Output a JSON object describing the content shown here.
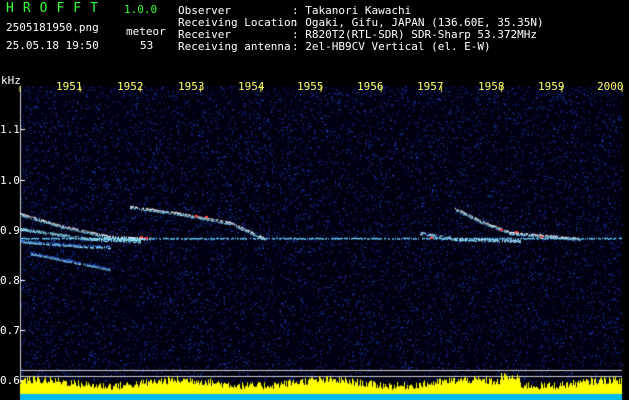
{
  "header": {
    "app_title": "HROFFT",
    "app_version": "1.0.0",
    "file_name": "2505181950.png",
    "timestamp": "25.05.18 19:50",
    "meteor_label": "meteor",
    "meteor_count": "53"
  },
  "info": [
    {
      "key": "Observer",
      "value": ": Takanori Kawachi"
    },
    {
      "key": "Receiving Location",
      "value": ": Ogaki, Gifu, JAPAN (136.60E, 35.35N)"
    },
    {
      "key": "Receiver",
      "value": ": R820T2(RTL-SDR) SDR-Sharp 53.372MHz"
    },
    {
      "key": "Receiving antenna",
      "value": ": 2el-HB9CV Vertical (el. E-W)"
    }
  ],
  "spectrogram": {
    "unit_label": "kHz",
    "y_labels": [
      "1.1",
      "1.0",
      "0.9",
      "0.8",
      "0.7",
      "0.6"
    ],
    "x_labels": [
      "1951",
      "1952",
      "1953",
      "1954",
      "1955",
      "1956",
      "1957",
      "1958",
      "1959",
      "2000"
    ],
    "colors": {
      "background": "#000010",
      "noise": "#1a2a9a",
      "carrier": "#66ccff",
      "trail": "#ffffff",
      "hot": "#ff4444",
      "meter": "#ffff00",
      "meter_base": "#00bbee"
    }
  }
}
